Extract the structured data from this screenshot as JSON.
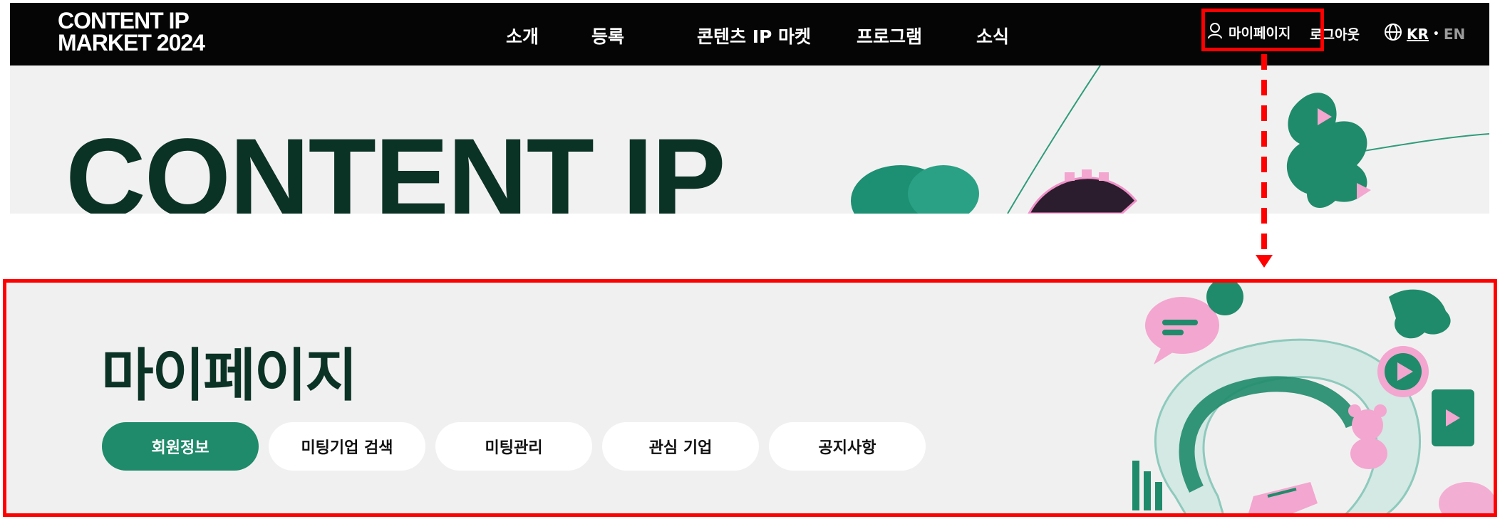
{
  "top_screenshot": {
    "logo_lines": [
      "CONTENT IP",
      "MARKET 2024"
    ],
    "nav": [
      "소개",
      "등록",
      "콘텐츠 IP 마켓",
      "프로그램",
      "소식"
    ],
    "mypage_label": "마이페이지",
    "logout_label": "로그아웃",
    "lang": {
      "kr": "KR",
      "separator": "•",
      "en": "EN"
    },
    "hero_text": "CONTENT IP",
    "icons": [
      "user-icon",
      "globe-icon"
    ]
  },
  "bottom_screenshot": {
    "title": "마이페이지",
    "tabs": [
      {
        "label": "회원정보",
        "active": true
      },
      {
        "label": "미팅기업 검색",
        "active": false
      },
      {
        "label": "미팅관리",
        "active": false
      },
      {
        "label": "관심 기업",
        "active": false
      },
      {
        "label": "공지사항",
        "active": false
      }
    ]
  },
  "colors": {
    "highlight": "#ff0000",
    "brand_green": "#1f8b6a",
    "dark_green": "#0b3325",
    "navbar": "#050505",
    "page_bg": "#f1f0f0",
    "pink": "#f3a6cf"
  }
}
